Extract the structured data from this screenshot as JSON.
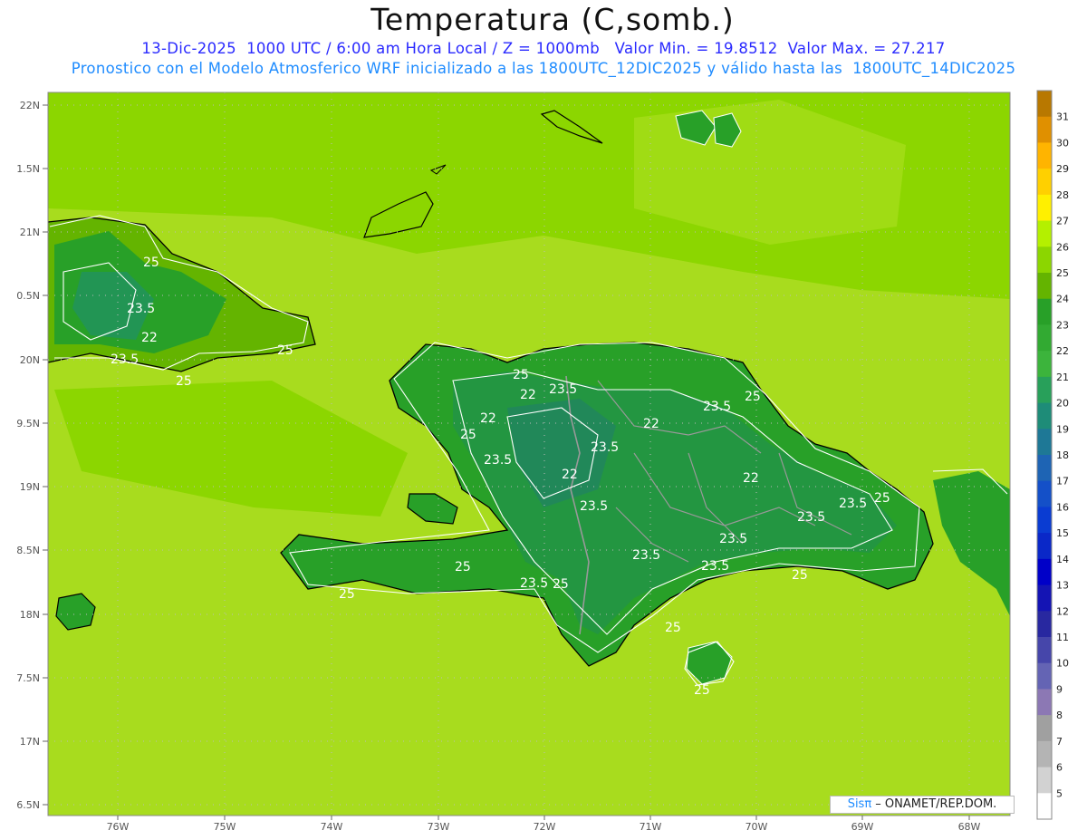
{
  "title": "Temperatura (C,somb.)",
  "subtitle_line1": "13-Dic-2025  1000 UTC / 6:00 am Hora Local / Z = 1000mb   Valor Min. = 19.8512  Valor Max. = 27.217",
  "subtitle_line2": "Pronostico con el Modelo Atmosferico WRF inicializado a las 1800UTC_12DIC2025 y válido hasta las  1800UTC_14DIC2025",
  "credit": {
    "brand": "Sisπ",
    "rest": " – ONAMET/REP.DOM."
  },
  "lat_labels": [
    "22N",
    "1.5N",
    "21N",
    "0.5N",
    "20N",
    "9.5N",
    "19N",
    "8.5N",
    "18N",
    "7.5N",
    "17N",
    "6.5N"
  ],
  "lon_labels": [
    "76W",
    "75W",
    "74W",
    "73W",
    "72W",
    "71W",
    "70W",
    "69W",
    "68W"
  ],
  "colorbar": {
    "labels": [
      "31",
      "30",
      "29",
      "28",
      "27",
      "26",
      "25",
      "24",
      "23",
      "22",
      "21",
      "20",
      "19",
      "18",
      "17",
      "16",
      "15",
      "14",
      "13",
      "12",
      "11",
      "10",
      "9",
      "8",
      "7",
      "6",
      "5"
    ],
    "colors": [
      "#b87800",
      "#e09000",
      "#ffb400",
      "#ffd000",
      "#fff000",
      "#b4f000",
      "#8cd600",
      "#64b400",
      "#28a028",
      "#32aa32",
      "#3cb43c",
      "#28a05a",
      "#1e8c78",
      "#1e7896",
      "#1e64b4",
      "#1450c8",
      "#0a3cd2",
      "#0a28c8",
      "#0000c8",
      "#1414b4",
      "#2828a0",
      "#4646aa",
      "#6464b4",
      "#8c78b4",
      "#a0a0a0",
      "#b4b4b4",
      "#d2d2d2",
      "#ffffff"
    ]
  },
  "contour_labels": [
    "25",
    "23.5",
    "22",
    "23.5",
    "25",
    "25",
    "25",
    "22",
    "23.5",
    "23.5",
    "22",
    "22",
    "25",
    "23.5",
    "25",
    "23.5",
    "22",
    "23.5",
    "22",
    "23.5",
    "25",
    "23.5",
    "23.5",
    "23.5",
    "23.5",
    "23.5",
    "25",
    "25",
    "25",
    "25",
    "25",
    "25"
  ]
}
